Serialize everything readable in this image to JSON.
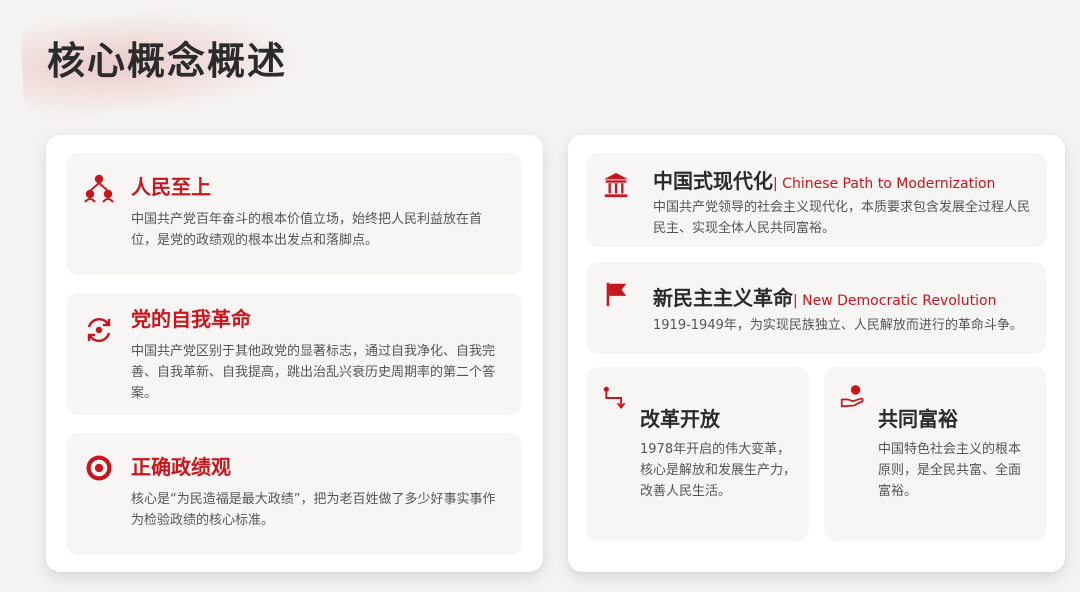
{
  "page": {
    "title": "核心概念概述"
  },
  "colors": {
    "accent": "#c8161d",
    "card_bg": "#f7f6f5",
    "panel_bg": "#ffffff",
    "page_bg": "#f4f3f1"
  },
  "left_cards": [
    {
      "icon": "people-network-icon",
      "title": "人民至上",
      "desc": "中国共产党百年奋斗的根本价值立场，始终把人民利益放在首位，是党的政绩观的根本出发点和落脚点。"
    },
    {
      "icon": "refresh-cycle-icon",
      "title": "党的自我革命",
      "desc": "中国共产党区别于其他政党的显著标志，通过自我净化、自我完善、自我革新、自我提高，跳出治乱兴衰历史周期率的第二个答案。"
    },
    {
      "icon": "target-icon",
      "title": "正确政绩观",
      "desc": "核心是“为民造福是最大政绩”，把为老百姓做了多少好事实事作为检验政绩的核心标准。"
    }
  ],
  "right_cards": {
    "modernization": {
      "icon": "pavilion-icon",
      "title": "中国式现代化",
      "subtitle": "| Chinese Path to Modernization",
      "desc": "中国共产党领导的社会主义现代化，本质要求包含发展全过程人民民主、实现全体人民共同富裕。"
    },
    "revolution": {
      "icon": "flag-icon",
      "title": "新民主主义革命",
      "subtitle": "| New Democratic Revolution",
      "desc": "1919-1949年，为实现民族独立、人民解放而进行的革命斗争。"
    },
    "reform": {
      "icon": "route-icon",
      "title": "改革开放",
      "desc": "1978年开启的伟大变革，核心是解放和发展生产力，改善人民生活。"
    },
    "prosperity": {
      "icon": "hand-coin-icon",
      "title": "共同富裕",
      "desc": "中国特色社会主义的根本原则，是全民共富、全面富裕。"
    }
  }
}
